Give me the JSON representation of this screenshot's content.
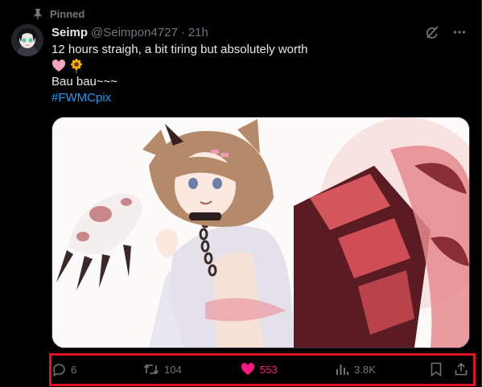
{
  "pinned": {
    "label": "Pinned"
  },
  "tweet": {
    "display_name": "Seimp",
    "handle": "@Seimpon4727",
    "separator": "·",
    "time": "21h",
    "lines": [
      "12 hours straigh, a bit tiring but absolutely worth",
      "Bau bau~~~"
    ],
    "emojis": [
      "pink-heart-emoji",
      "sunflower-emoji"
    ],
    "hashtag": "#FWMCpix"
  },
  "actions": {
    "replies": "6",
    "reposts": "104",
    "likes": "553",
    "views": "3.8K"
  },
  "colors": {
    "background": "#000000",
    "text": "#e7e9ea",
    "muted": "#71767b",
    "link": "#1d9bf0",
    "like": "#f91880",
    "highlight": "#e3131d"
  },
  "icons": {
    "pin": "pin-icon",
    "grok": "grok-icon",
    "more": "more-icon",
    "reply": "reply-icon",
    "repost": "repost-icon",
    "like": "heart-icon",
    "views": "views-icon",
    "bookmark": "bookmark-icon",
    "share": "share-icon"
  }
}
